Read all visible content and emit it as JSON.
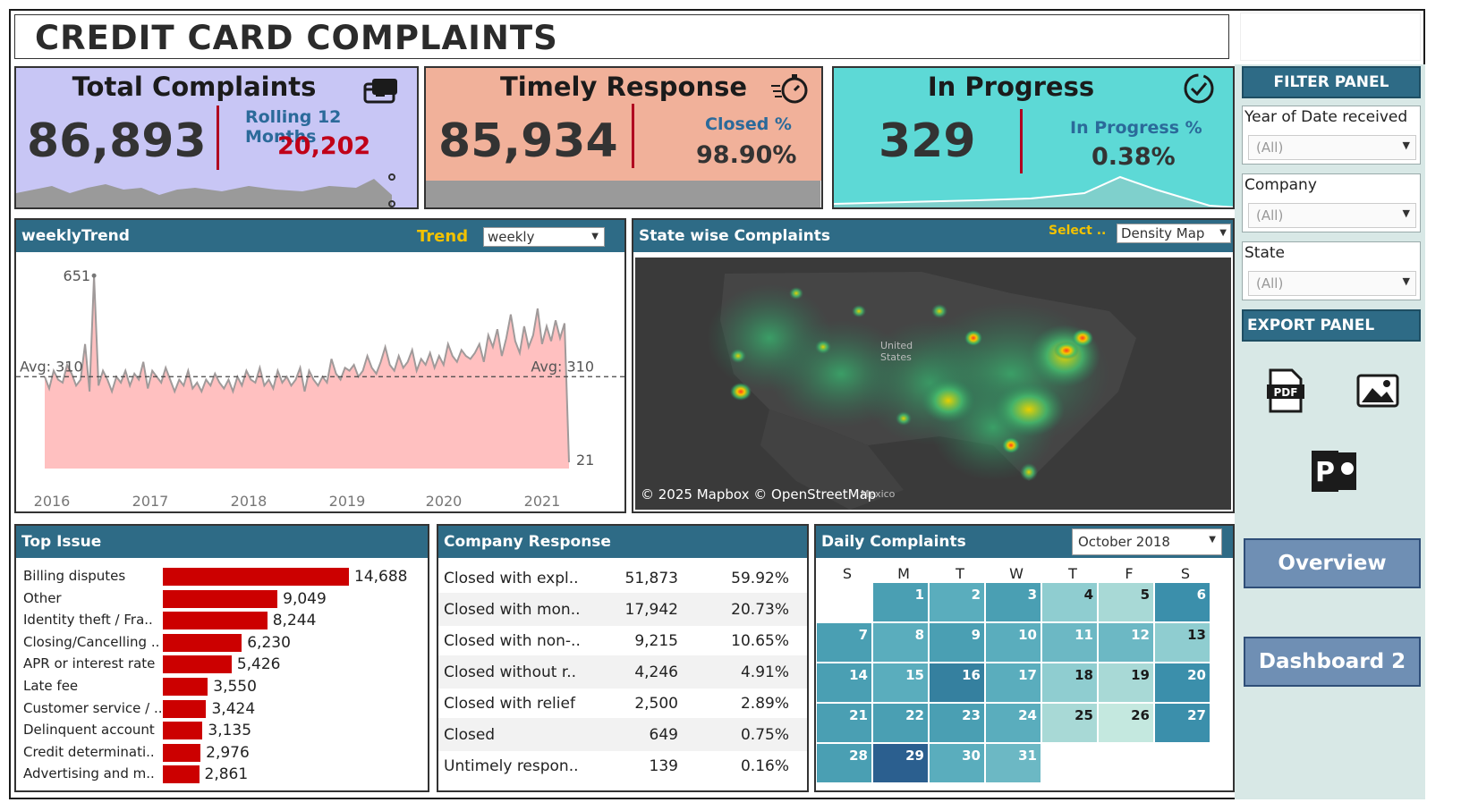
{
  "title": "CREDIT CARD COMPLAINTS",
  "kpis": {
    "total": {
      "label": "Total Complaints",
      "value": "86,893",
      "sub_label": "Rolling 12 Months",
      "sub_value": "20,202",
      "bg": "#c8c6f5",
      "icon": "credit-card-icon"
    },
    "timely": {
      "label": "Timely Response",
      "value": "85,934",
      "sub_label": "Closed %",
      "sub_value": "98.90%",
      "bg": "#f1b19a",
      "icon": "stopwatch-icon",
      "progress": 0.989
    },
    "progress": {
      "label": "In Progress",
      "value": "329",
      "sub_label": "In Progress %",
      "sub_value": "0.38%",
      "bg": "#5dd9d6",
      "icon": "check-circle-icon"
    }
  },
  "weekly_trend": {
    "header": "weeklyTrend",
    "trend_label": "Trend",
    "trend_value": "weekly",
    "max_label": "651",
    "min_label": "21",
    "avg_left": "Avg: 310",
    "avg_right": "Avg: 310",
    "chart_data": {
      "type": "area",
      "x_ticks": [
        "2016",
        "2017",
        "2018",
        "2019",
        "2020",
        "2021"
      ],
      "avg": 310,
      "max": 651,
      "last": 21,
      "ylim": [
        0,
        700
      ],
      "values": [
        310,
        270,
        330,
        300,
        290,
        350,
        320,
        280,
        300,
        420,
        260,
        651,
        280,
        330,
        300,
        260,
        310,
        290,
        330,
        280,
        320,
        300,
        360,
        270,
        330,
        310,
        290,
        340,
        300,
        260,
        300,
        280,
        330,
        270,
        290,
        260,
        300,
        280,
        320,
        290,
        270,
        300,
        260,
        310,
        280,
        330,
        300,
        290,
        340,
        280,
        300,
        270,
        330,
        290,
        310,
        280,
        300,
        340,
        260,
        330,
        300,
        280,
        310,
        290,
        370,
        320,
        300,
        340,
        330,
        350,
        310,
        330,
        380,
        340,
        320,
        360,
        410,
        350,
        330,
        380,
        340,
        360,
        400,
        330,
        370,
        350,
        390,
        340,
        380,
        350,
        420,
        380,
        360,
        400,
        380,
        370,
        390,
        420,
        360,
        450,
        410,
        470,
        380,
        440,
        520,
        430,
        390,
        480,
        410,
        450,
        540,
        420,
        480,
        430,
        500,
        440,
        490,
        21
      ]
    }
  },
  "state_map": {
    "header": "State wise Complaints",
    "select_label": "Select ..",
    "select_value": "Density Map",
    "credit": "© 2025 Mapbox © OpenStreetMap",
    "country_label": "United States",
    "neighbor_label": "Mexico"
  },
  "filter_panel": {
    "header": "FILTER PANEL",
    "filters": [
      {
        "label": "Year of Date received",
        "value": "(All)"
      },
      {
        "label": "Company",
        "value": "(All)"
      },
      {
        "label": "State",
        "value": "(All)"
      }
    ]
  },
  "export_panel": {
    "header": "EXPORT PANEL",
    "icons": [
      "pdf-icon",
      "image-icon",
      "powerpoint-icon"
    ]
  },
  "nav": {
    "overview": "Overview",
    "dashboard2": "Dashboard 2"
  },
  "top_issue": {
    "header": "Top Issue",
    "chart_data": {
      "type": "bar",
      "categories": [
        "Billing disputes",
        "Other",
        "Identity theft / Fra..",
        "Closing/Cancelling ..",
        "APR or interest rate",
        "Late fee",
        "Customer service / ..",
        "Delinquent account",
        "Credit determinati..",
        "Advertising and m.."
      ],
      "values": [
        14688,
        9049,
        8244,
        6230,
        5426,
        3550,
        3424,
        3135,
        2976,
        2861
      ],
      "labels": [
        "14,688",
        "9,049",
        "8,244",
        "6,230",
        "5,426",
        "3,550",
        "3,424",
        "3,135",
        "2,976",
        "2,861"
      ]
    }
  },
  "company_response": {
    "header": "Company Response",
    "rows": [
      {
        "name": "Closed with expl..",
        "count": "51,873",
        "pct": "59.92%"
      },
      {
        "name": "Closed with mon..",
        "count": "17,942",
        "pct": "20.73%"
      },
      {
        "name": "Closed with non-..",
        "count": "9,215",
        "pct": "10.65%"
      },
      {
        "name": "Closed without r..",
        "count": "4,246",
        "pct": "4.91%"
      },
      {
        "name": "Closed with relief",
        "count": "2,500",
        "pct": "2.89%"
      },
      {
        "name": "Closed",
        "count": "649",
        "pct": "0.75%"
      },
      {
        "name": "Untimely respon..",
        "count": "139",
        "pct": "0.16%"
      }
    ]
  },
  "daily": {
    "header": "Daily Complaints",
    "month": "October 2018",
    "dow": [
      "S",
      "M",
      "T",
      "W",
      "T",
      "F",
      "S"
    ],
    "start_offset": 1,
    "days": [
      {
        "d": "1",
        "c": "#4a9fb3"
      },
      {
        "d": "2",
        "c": "#5aadbd"
      },
      {
        "d": "3",
        "c": "#4a9fb3"
      },
      {
        "d": "4",
        "c": "#8fcdd0"
      },
      {
        "d": "5",
        "c": "#a8d9d6"
      },
      {
        "d": "6",
        "c": "#3b8fab"
      },
      {
        "d": "7",
        "c": "#4a9fb3"
      },
      {
        "d": "8",
        "c": "#5aadbd"
      },
      {
        "d": "9",
        "c": "#4a9fb3"
      },
      {
        "d": "10",
        "c": "#5aadbd"
      },
      {
        "d": "11",
        "c": "#6cb8c4"
      },
      {
        "d": "12",
        "c": "#6cb8c4"
      },
      {
        "d": "13",
        "c": "#8fcdd0"
      },
      {
        "d": "14",
        "c": "#4a9fb3"
      },
      {
        "d": "15",
        "c": "#5aadbd"
      },
      {
        "d": "16",
        "c": "#35809f"
      },
      {
        "d": "17",
        "c": "#5aadbd"
      },
      {
        "d": "18",
        "c": "#8fcdd0"
      },
      {
        "d": "19",
        "c": "#a8d9d6"
      },
      {
        "d": "20",
        "c": "#3b8fab"
      },
      {
        "d": "21",
        "c": "#4a9fb3"
      },
      {
        "d": "22",
        "c": "#4a9fb3"
      },
      {
        "d": "23",
        "c": "#4a9fb3"
      },
      {
        "d": "24",
        "c": "#5aadbd"
      },
      {
        "d": "25",
        "c": "#a8d9d6"
      },
      {
        "d": "26",
        "c": "#c4e8df"
      },
      {
        "d": "27",
        "c": "#3b8fab"
      },
      {
        "d": "28",
        "c": "#4a9fb3"
      },
      {
        "d": "29",
        "c": "#2b5f8f"
      },
      {
        "d": "30",
        "c": "#5aadbd"
      },
      {
        "d": "31",
        "c": "#6cb8c4"
      }
    ]
  }
}
